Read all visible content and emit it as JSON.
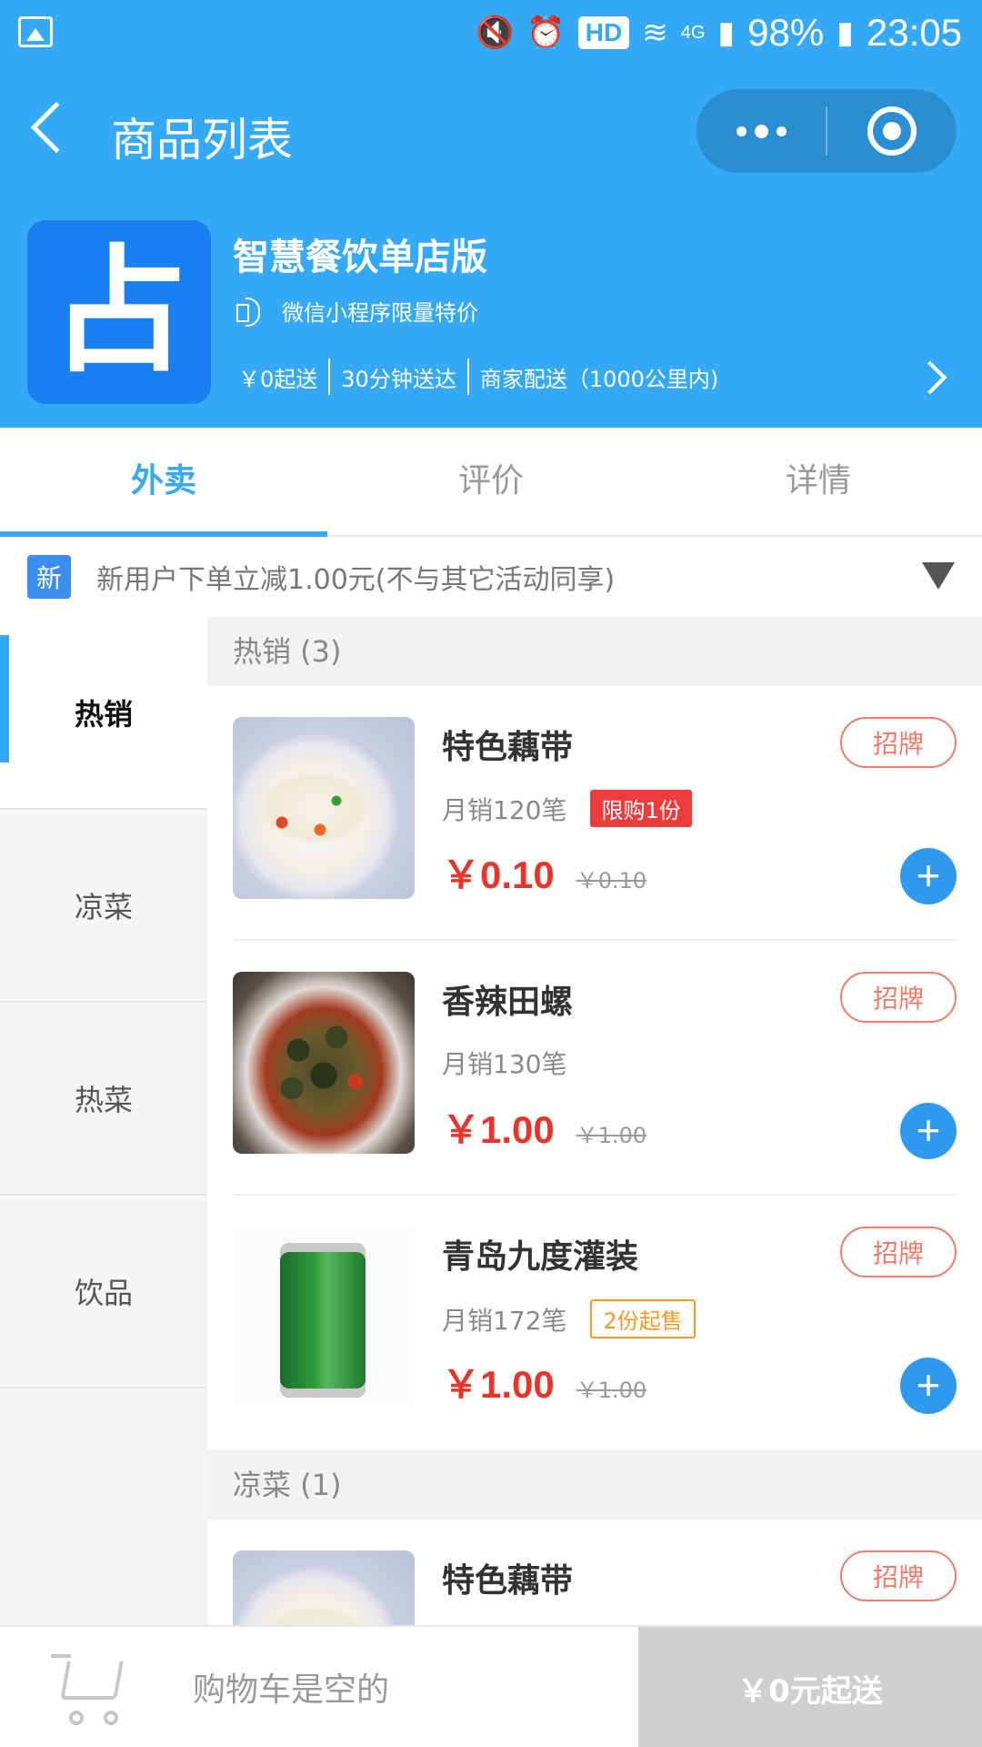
{
  "status_bar": {
    "battery": "98%",
    "time": "23:05",
    "hd": "HD",
    "signal": "4G"
  },
  "nav": {
    "title": "商品列表"
  },
  "shop": {
    "logo_char": "占",
    "name": "智慧餐饮单店版",
    "notice": "微信小程序限量特价",
    "tags": [
      "￥0起送",
      "30分钟送达",
      "商家配送（1000公里内)"
    ]
  },
  "tabs": [
    {
      "label": "外卖",
      "active": true
    },
    {
      "label": "评价",
      "active": false
    },
    {
      "label": "详情",
      "active": false
    }
  ],
  "promo": {
    "badge": "新",
    "text": "新用户下单立减1.00元(不与其它活动同享)"
  },
  "categories": [
    {
      "label": "热销",
      "active": true
    },
    {
      "label": "凉菜",
      "active": false
    },
    {
      "label": "热菜",
      "active": false
    },
    {
      "label": "饮品",
      "active": false
    }
  ],
  "sections": [
    {
      "title": "热销 (3)",
      "items": [
        {
          "name": "特色藕带",
          "badge": "招牌",
          "sales": "月销120笔",
          "tag": "限购1份",
          "price": "￥0.10",
          "original": "￥0.10"
        },
        {
          "name": "香辣田螺",
          "badge": "招牌",
          "sales": "月销130笔",
          "price": "￥1.00",
          "original": "￥1.00"
        },
        {
          "name": "青岛九度灌装",
          "badge": "招牌",
          "sales": "月销172笔",
          "tag": "2份起售",
          "price": "￥1.00",
          "original": "￥1.00"
        }
      ]
    },
    {
      "title": "凉菜 (1)",
      "items": [
        {
          "name": "特色藕带",
          "badge": "招牌"
        }
      ]
    }
  ],
  "cart": {
    "empty_text": "购物车是空的",
    "checkout_label": "￥0元起送"
  },
  "colors": {
    "primary": "#35a9f5",
    "price": "#e8342a",
    "badge": "#ef7b6a",
    "limit": "#ee3b3b",
    "minbuy": "#f39a2a"
  }
}
